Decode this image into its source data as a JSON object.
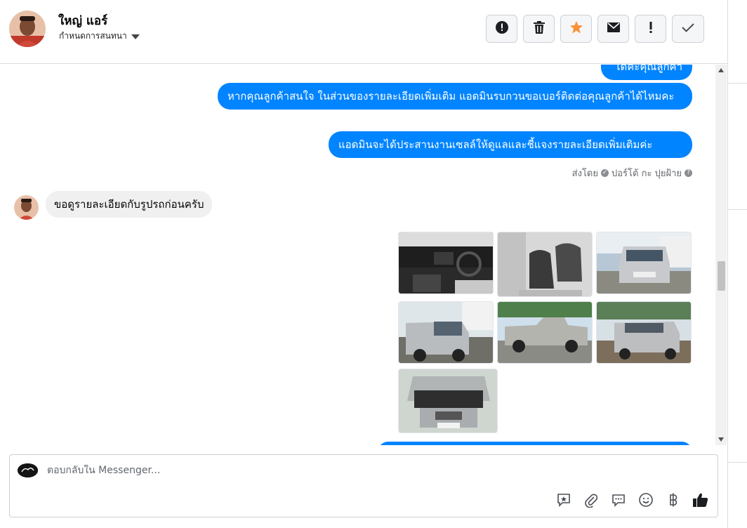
{
  "header": {
    "contact_name": "ใหญ่ แอร์",
    "assign_label": "กำหนดการสนทนา",
    "toolbar": [
      {
        "name": "report-spam-button",
        "icon": "alert-circle-icon"
      },
      {
        "name": "delete-button",
        "icon": "trash-icon"
      },
      {
        "name": "star-button",
        "icon": "star-icon"
      },
      {
        "name": "mark-unread-button",
        "icon": "envelope-icon"
      },
      {
        "name": "important-button",
        "icon": "exclamation-icon"
      },
      {
        "name": "mark-done-button",
        "icon": "check-icon"
      }
    ]
  },
  "thread": {
    "messages_out": [
      "ได้ค่ะคุณลูกค้า",
      "หากคุณลูกค้าสนใจ ในส่วนของรายละเอียดเพิ่มเติม แอดมินรบกวนขอเบอร์ติดต่อคุณลูกค้าได้ไหมคะ",
      "แอดมินจะได้ประสานงานเซลล์ให้ดูแลและชี้แจงรายละเอียดเพิ่มเติมค่ะ"
    ],
    "sent_by": {
      "prefix": "ส่งโดย",
      "name": "ปอร์โต้ กะ ปุยฝ้าย"
    },
    "message_in": "ขอดูรายละเอียดกับรูปรถก่อนครับ",
    "photos": [
      "interior-dashboard",
      "interior-seats",
      "front-view",
      "rear-view-left",
      "side-view",
      "rear-view-right",
      "engine-bay"
    ]
  },
  "composer": {
    "placeholder": "ตอบกลับใน Messenger...",
    "icons": [
      "saved-reply-icon",
      "attachment-icon",
      "chat-bubble-icon",
      "emoji-icon",
      "baht-icon",
      "thumbs-up-icon"
    ]
  },
  "colors": {
    "accent": "#0084ff",
    "incoming_bubble": "#f0f0f0",
    "star": "#f7923b"
  }
}
